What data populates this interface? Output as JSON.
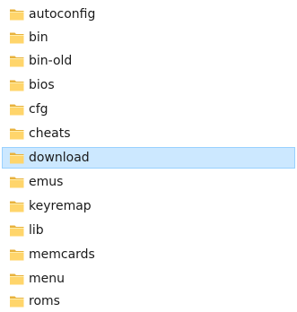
{
  "folders": [
    {
      "label": "autoconfig",
      "icon": "folder-icon",
      "selected": false
    },
    {
      "label": "bin",
      "icon": "folder-icon",
      "selected": false
    },
    {
      "label": "bin-old",
      "icon": "folder-icon",
      "selected": false
    },
    {
      "label": "bios",
      "icon": "folder-icon",
      "selected": false
    },
    {
      "label": "cfg",
      "icon": "folder-icon",
      "selected": false
    },
    {
      "label": "cheats",
      "icon": "folder-icon",
      "selected": false
    },
    {
      "label": "download",
      "icon": "folder-icon",
      "selected": true
    },
    {
      "label": "emus",
      "icon": "folder-icon",
      "selected": false
    },
    {
      "label": "keyremap",
      "icon": "folder-icon",
      "selected": false
    },
    {
      "label": "lib",
      "icon": "folder-icon",
      "selected": false
    },
    {
      "label": "memcards",
      "icon": "folder-icon",
      "selected": false
    },
    {
      "label": "menu",
      "icon": "folder-icon",
      "selected": false
    },
    {
      "label": "roms",
      "icon": "folder-icon",
      "selected": false
    }
  ],
  "colors": {
    "folder_body": "#ffd56b",
    "folder_back": "#e8b23c",
    "selection_bg": "#cce8ff",
    "selection_border": "#99d1ff"
  }
}
